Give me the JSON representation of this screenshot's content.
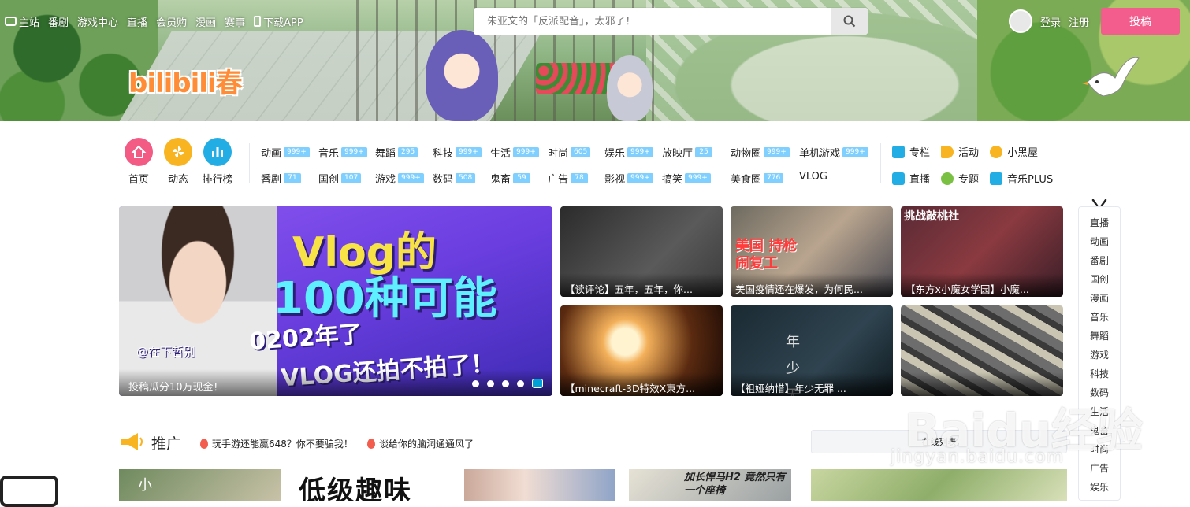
{
  "topnav": {
    "items": [
      "主站",
      "番剧",
      "游戏中心",
      "直播",
      "会员购",
      "漫画",
      "赛事",
      "下载APP"
    ]
  },
  "logo": "bilibili春",
  "search": {
    "placeholder": "朱亚文的「反派配音」，太邪了！"
  },
  "user": {
    "login": "登录",
    "register": "注册",
    "upload": "投稿"
  },
  "primary": [
    {
      "label": "首页",
      "color": "#f35a84"
    },
    {
      "label": "动态",
      "color": "#f9b421"
    },
    {
      "label": "排行榜",
      "color": "#23ade5"
    }
  ],
  "categories_row1": [
    {
      "label": "动画",
      "count": "999+"
    },
    {
      "label": "音乐",
      "count": "999+"
    },
    {
      "label": "舞蹈",
      "count": "295"
    },
    {
      "label": "科技",
      "count": "999+"
    },
    {
      "label": "生活",
      "count": "999+"
    },
    {
      "label": "时尚",
      "count": "605"
    },
    {
      "label": "娱乐",
      "count": "999+"
    },
    {
      "label": "放映厅",
      "count": "25"
    },
    {
      "label": "动物圈",
      "count": "999+"
    },
    {
      "label": "单机游戏",
      "count": "999+"
    }
  ],
  "categories_row2": [
    {
      "label": "番剧",
      "count": "71"
    },
    {
      "label": "国创",
      "count": "107"
    },
    {
      "label": "游戏",
      "count": "999+"
    },
    {
      "label": "数码",
      "count": "508"
    },
    {
      "label": "鬼畜",
      "count": "59"
    },
    {
      "label": "广告",
      "count": "78"
    },
    {
      "label": "影视",
      "count": "999+"
    },
    {
      "label": "搞笑",
      "count": "999+"
    },
    {
      "label": "美食圈",
      "count": "776"
    },
    {
      "label": "VLOG",
      "count": ""
    }
  ],
  "side_links": [
    {
      "label": "专栏",
      "icon": "column-icon",
      "color": "#23ade5"
    },
    {
      "label": "活动",
      "icon": "flag-icon",
      "color": "#f9b421"
    },
    {
      "label": "小黑屋",
      "icon": "scales-icon",
      "color": "#f9b421"
    },
    {
      "label": "直播",
      "icon": "live-icon",
      "color": "#23ade5"
    },
    {
      "label": "专题",
      "icon": "chat-icon",
      "color": "#7ac143"
    },
    {
      "label": "音乐PLUS",
      "icon": "music-icon",
      "color": "#23ade5"
    }
  ],
  "carousel": {
    "line1": "Vlog的",
    "line2": "100种可能",
    "line3": "0202年了",
    "line4": "VLOG还拍不拍了！",
    "handle": "@在下哲别",
    "caption": "投稿瓜分10万现金！"
  },
  "tiles": [
    {
      "caption": "【读评论】五年，五年，你..."
    },
    {
      "caption": "美国疫情还在爆发，为何民...",
      "tag": "美国 持枪闹复工"
    },
    {
      "caption": "【东方x小魔女学园】小魔...",
      "tag": "挑战敲桃社"
    },
    {
      "caption": "【minecraft-3D特效X東方..."
    },
    {
      "caption": "【祖娅纳惜】年少无罪 ...",
      "tag": "年 少 无 罪"
    },
    {
      "caption": ""
    }
  ],
  "sidenav": [
    "直播",
    "动画",
    "番剧",
    "国创",
    "漫画",
    "音乐",
    "舞蹈",
    "游戏",
    "科技",
    "数码",
    "生活",
    "鬼畜",
    "时尚",
    "广告",
    "娱乐"
  ],
  "promo": {
    "title": "推广",
    "links": [
      "玩手游还能赢648？你不要骗我！",
      "谈给你的脑洞通通风了"
    ],
    "online": "在线列表"
  },
  "bottom_cards": [
    "小",
    "低级趣味",
    "",
    "加长悍马H2 竟然只有一个座椅",
    ""
  ],
  "watermark": "Baidu经验",
  "watermark_url": "jingyan.baidu.com"
}
